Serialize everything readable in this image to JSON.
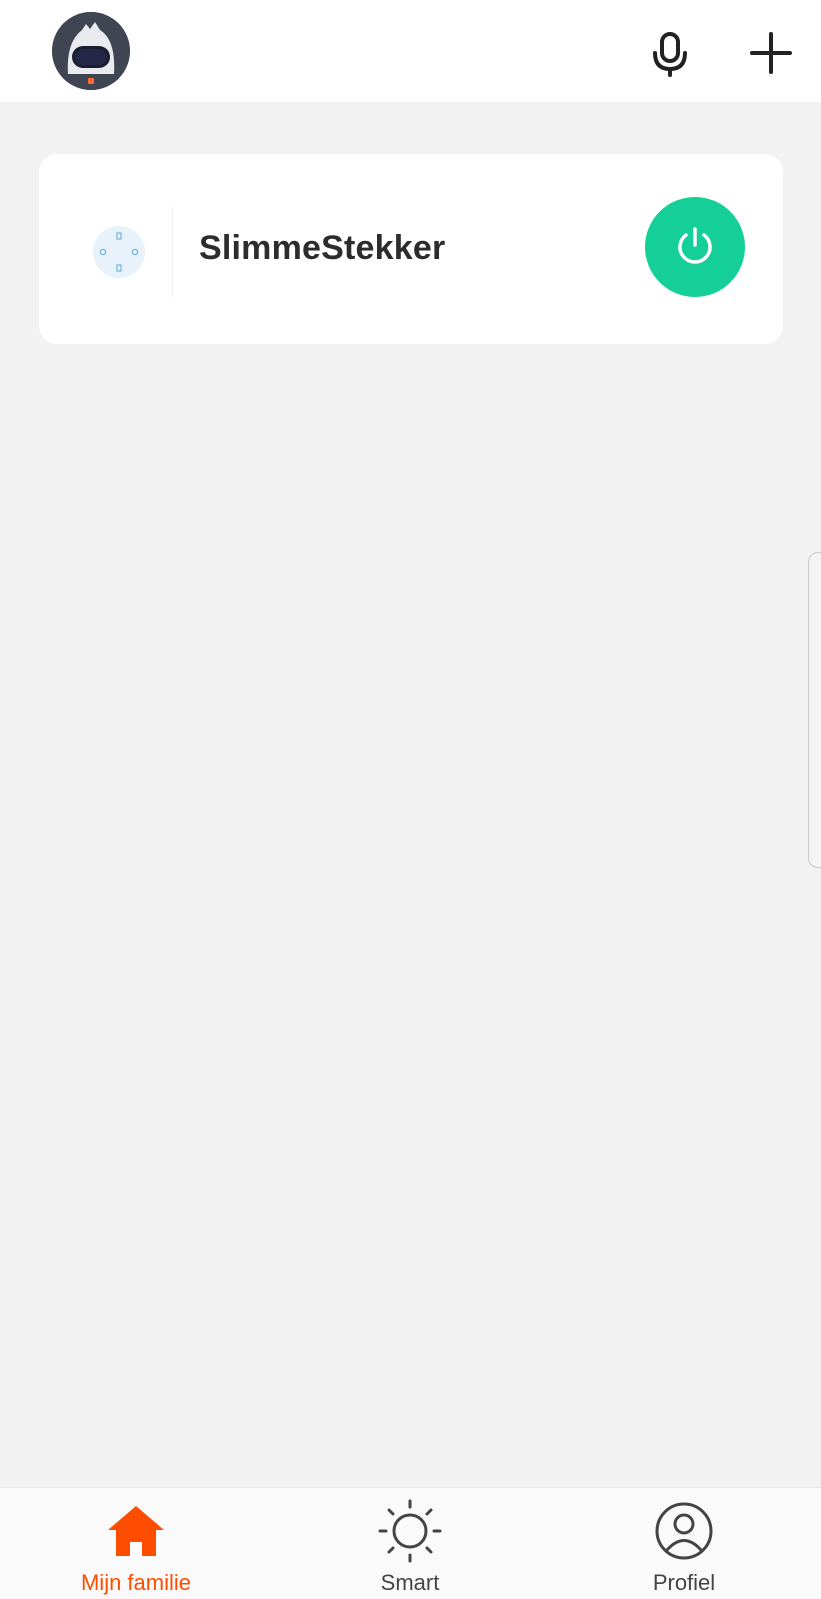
{
  "colors": {
    "accent": "#ff4d00",
    "power_on": "#14cf98",
    "tab_inactive": "#444444",
    "text_primary": "#2c2c2c"
  },
  "header": {
    "avatar_icon": "astronaut-avatar",
    "mic_icon": "microphone-icon",
    "add_icon": "plus-icon"
  },
  "devices": [
    {
      "name": "SlimmeStekker",
      "icon": "smart-plug-icon",
      "power_state": "on"
    }
  ],
  "tabbar": {
    "items": [
      {
        "label": "Mijn familie",
        "icon": "home-icon",
        "active": true
      },
      {
        "label": "Smart",
        "icon": "sun-icon",
        "active": false
      },
      {
        "label": "Profiel",
        "icon": "user-circle-icon",
        "active": false
      }
    ]
  }
}
